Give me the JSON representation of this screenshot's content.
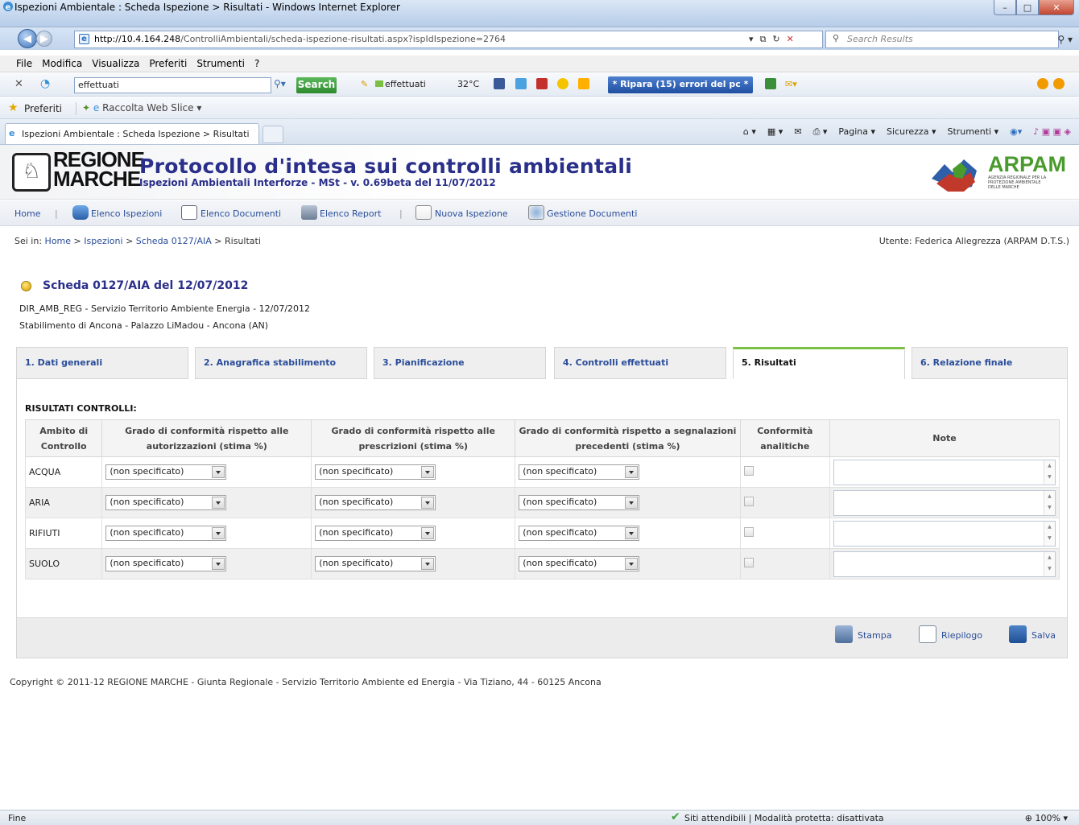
{
  "window": {
    "title": "Ispezioni Ambientale : Scheda Ispezione > Risultati - Windows Internet Explorer"
  },
  "address": {
    "url_host": "http://10.4.164.248",
    "url_path": "/ControlliAmbientali/scheda-ispezione-risultati.aspx?ispIdIspezione=2764",
    "search_placeholder": "Search Results"
  },
  "menu": [
    "File",
    "Modifica",
    "Visualizza",
    "Preferiti",
    "Strumenti",
    "?"
  ],
  "toolbar": {
    "search_value": "effettuati",
    "search_button": "Search",
    "effettuati_label": "effettuati",
    "weather": "32°C",
    "ripara": "* Ripara (15) errori del pc *"
  },
  "favorites": {
    "preferiti": "Preferiti",
    "web_slice": "Raccolta Web Slice ▾"
  },
  "browser_tab": {
    "title": "Ispezioni Ambientale : Scheda Ispezione > Risultati"
  },
  "commands": [
    "Pagina ▾",
    "Sicurezza ▾",
    "Strumenti ▾"
  ],
  "banner": {
    "logo_line1": "REGIONE",
    "logo_line2": "MARCHE",
    "title": "Protocollo d'intesa sui controlli ambientali",
    "subtitle": "Ispezioni Ambientali Interforze - MSt - v. 0.69beta del 11/07/2012",
    "arpam": "ARPAM",
    "arpam_small": "AGENZIA REGIONALE PER LA PROTEZIONE AMBIENTALE DELLE MARCHE"
  },
  "nav": {
    "home": "Home",
    "elenco_ispezioni": "Elenco Ispezioni",
    "elenco_documenti": "Elenco Documenti",
    "elenco_report": "Elenco Report",
    "nuova_ispezione": "Nuova Ispezione",
    "gestione_documenti": "Gestione Documenti"
  },
  "breadcrumb": {
    "prefix": "Sei in:",
    "home": "Home",
    "ispezioni": "Ispezioni",
    "scheda": "Scheda 0127/AIA",
    "current": "Risultati"
  },
  "user": "Utente: Federica Allegrezza (ARPAM D.T.S.)",
  "scheda": {
    "title": "Scheda 0127/AIA del 12/07/2012",
    "line1": "DIR_AMB_REG - Servizio Territorio Ambiente Energia - 12/07/2012",
    "line2": "Stabilimento di Ancona - Palazzo LiMadou - Ancona (AN)"
  },
  "tabs": [
    {
      "label": "1. Dati generali"
    },
    {
      "label": "2. Anagrafica stabilimento"
    },
    {
      "label": "3. Pianificazione"
    },
    {
      "label": "4. Controlli effettuati"
    },
    {
      "label": "5. Risultati"
    },
    {
      "label": "6. Relazione finale"
    }
  ],
  "results": {
    "heading": "RISULTATI CONTROLLI:",
    "headers": {
      "ambito": "Ambito di Controllo",
      "autorizzazioni": "Grado di conformità rispetto alle autorizzazioni (stima %)",
      "prescrizioni": "Grado di conformità rispetto alle prescrizioni (stima %)",
      "segnalazioni": "Grado di conformità rispetto a segnalazioni precedenti (stima %)",
      "analitiche": "Conformità analitiche",
      "note": "Note"
    },
    "rows": [
      {
        "ambito": "ACQUA",
        "aut": "(non specificato)",
        "pre": "(non specificato)",
        "seg": "(non specificato)"
      },
      {
        "ambito": "ARIA",
        "aut": "(non specificato)",
        "pre": "(non specificato)",
        "seg": "(non specificato)"
      },
      {
        "ambito": "RIFIUTI",
        "aut": "(non specificato)",
        "pre": "(non specificato)",
        "seg": "(non specificato)"
      },
      {
        "ambito": "SUOLO",
        "aut": "(non specificato)",
        "pre": "(non specificato)",
        "seg": "(non specificato)"
      }
    ]
  },
  "footer_buttons": {
    "stampa": "Stampa",
    "riepilogo": "Riepilogo",
    "salva": "Salva"
  },
  "copyright": "Copyright © 2011-12 REGIONE MARCHE - Giunta Regionale - Servizio Territorio Ambiente ed Energia - Via Tiziano, 44 - 60125 Ancona",
  "status": {
    "left": "Fine",
    "zone": "Siti attendibili | Modalità protetta: disattivata",
    "zoom": "100%"
  }
}
